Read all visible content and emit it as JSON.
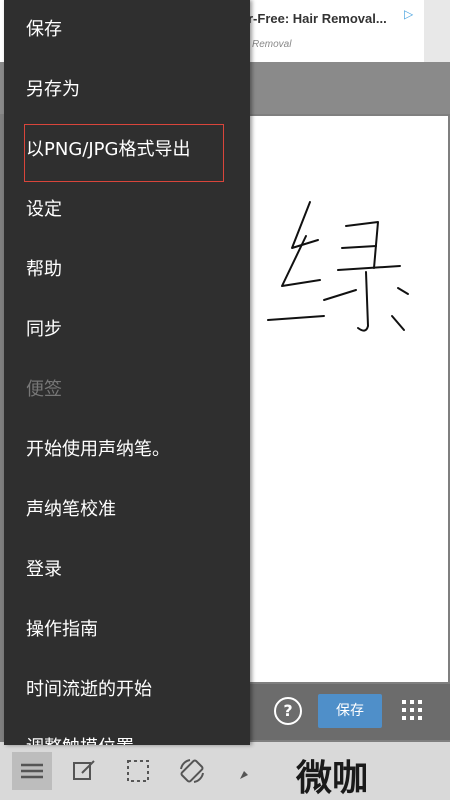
{
  "ad": {
    "title": "r-Free: Hair Removal...",
    "subtitle": "Removal",
    "play_icon": "ad-choices-icon"
  },
  "menu": {
    "items": [
      {
        "label": "保存",
        "enabled": true
      },
      {
        "label": "另存为",
        "enabled": true
      },
      {
        "label": "以PNG/JPG格式导出",
        "enabled": true,
        "highlighted": true
      },
      {
        "label": "设定",
        "enabled": true
      },
      {
        "label": "帮助",
        "enabled": true
      },
      {
        "label": "同步",
        "enabled": true
      },
      {
        "label": "便签",
        "enabled": false
      },
      {
        "label": "开始使用声纳笔。",
        "enabled": true
      },
      {
        "label": "声纳笔校准",
        "enabled": true
      },
      {
        "label": "登录",
        "enabled": true
      },
      {
        "label": "操作指南",
        "enabled": true
      },
      {
        "label": "时间流逝的开始",
        "enabled": true
      },
      {
        "label": "调整触摸位置",
        "enabled": true
      }
    ],
    "highlight_color": "#d9453b"
  },
  "bottom_bar": {
    "help_label": "?",
    "save_label": "保存",
    "save_color": "#4f8fc9"
  },
  "toolbar": {
    "tools": [
      "menu-icon",
      "edit-icon",
      "select-icon",
      "rotate-icon",
      "pen-icon"
    ]
  },
  "watermark": {
    "text": "微咖"
  }
}
